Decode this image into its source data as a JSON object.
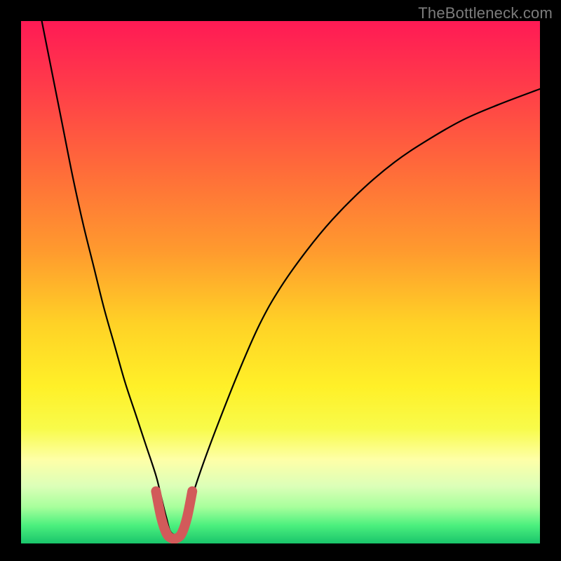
{
  "watermark": "TheBottleneck.com",
  "chart_data": {
    "type": "line",
    "title": "",
    "xlabel": "",
    "ylabel": "",
    "xlim": [
      0,
      100
    ],
    "ylim": [
      0,
      100
    ],
    "grid": false,
    "series": [
      {
        "name": "bottleneck-curve",
        "x": [
          4,
          6,
          8,
          10,
          12,
          14,
          16,
          18,
          20,
          22,
          24,
          26,
          27,
          28,
          29,
          31,
          32,
          33,
          35,
          38,
          42,
          46,
          50,
          55,
          60,
          66,
          72,
          78,
          85,
          92,
          100
        ],
        "y": [
          100,
          90,
          80,
          70,
          61,
          53,
          45,
          38,
          31,
          25,
          19,
          13,
          9,
          5,
          2,
          2,
          5,
          9,
          15,
          23,
          33,
          42,
          49,
          56,
          62,
          68,
          73,
          77,
          81,
          84,
          87
        ]
      },
      {
        "name": "highlight-valley",
        "x": [
          26,
          27,
          28,
          29,
          30,
          31,
          32,
          33
        ],
        "y": [
          10,
          5,
          2,
          1,
          1,
          2,
          5,
          10
        ]
      }
    ],
    "gradient_stops": [
      {
        "offset": 0.0,
        "color": "#ff1a55"
      },
      {
        "offset": 0.12,
        "color": "#ff3a4a"
      },
      {
        "offset": 0.28,
        "color": "#ff6a3a"
      },
      {
        "offset": 0.44,
        "color": "#ff9a2e"
      },
      {
        "offset": 0.58,
        "color": "#ffd226"
      },
      {
        "offset": 0.7,
        "color": "#fff028"
      },
      {
        "offset": 0.78,
        "color": "#f8fb4a"
      },
      {
        "offset": 0.84,
        "color": "#feffa8"
      },
      {
        "offset": 0.89,
        "color": "#dcffb8"
      },
      {
        "offset": 0.93,
        "color": "#a8ff9c"
      },
      {
        "offset": 0.965,
        "color": "#4cf07e"
      },
      {
        "offset": 1.0,
        "color": "#19c56b"
      }
    ],
    "curve_stroke": "#000000",
    "highlight_stroke": "#d25a5a"
  }
}
